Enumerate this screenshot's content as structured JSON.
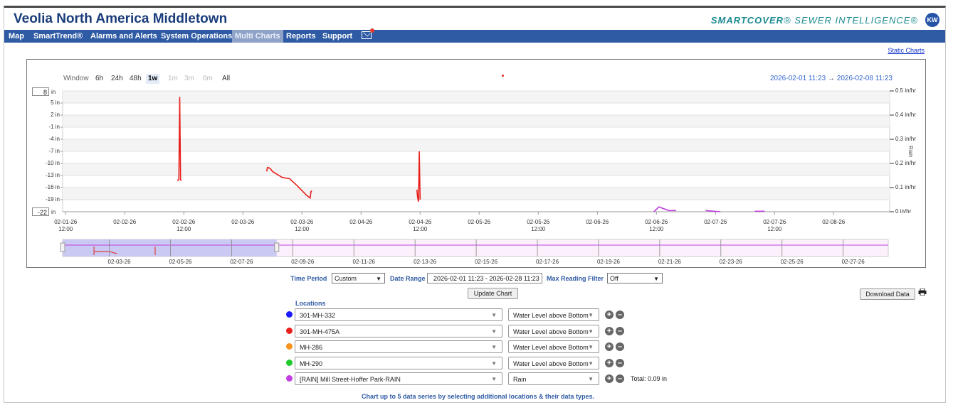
{
  "header": {
    "title": "Veolia North America Middletown",
    "brand_main": "SMARTCOVER",
    "brand_rest": "® SEWER INTELLIGENCE®",
    "avatar": "KW"
  },
  "nav": {
    "items": [
      {
        "label": "Map",
        "active": false
      },
      {
        "label": "SmartTrend®",
        "active": false
      },
      {
        "label": "Alarms and Alerts",
        "active": false
      },
      {
        "label": "System Operations",
        "active": false
      },
      {
        "label": "Multi Charts",
        "active": true
      },
      {
        "label": "Reports",
        "active": false
      },
      {
        "label": "Support",
        "active": false
      }
    ],
    "mail_icon": "envelope-icon"
  },
  "static_charts_link": "Static Charts",
  "range_selector": {
    "label": "Window",
    "buttons": [
      {
        "label": "6h",
        "state": "normal"
      },
      {
        "label": "24h",
        "state": "normal"
      },
      {
        "label": "48h",
        "state": "normal"
      },
      {
        "label": "1w",
        "state": "selected"
      },
      {
        "label": "1m",
        "state": "disabled"
      },
      {
        "label": "3m",
        "state": "disabled"
      },
      {
        "label": "6m",
        "state": "disabled"
      },
      {
        "label": "All",
        "state": "normal"
      }
    ],
    "from": "2026-02-01 11:23",
    "arrow": "→",
    "to": "2026-02-08 11:23"
  },
  "chart_data": {
    "type": "line",
    "y_left_max_input": "8",
    "y_left_min_input": "-22",
    "y_left_unit": "in",
    "y_left_ticks": [
      "5 in",
      "2 in",
      "-1 in",
      "-4 in",
      "-7 in",
      "-10 in",
      "-13 in",
      "-16 in",
      "-19 in"
    ],
    "y_left_range": [
      -22,
      8
    ],
    "y_right_ticks": [
      "0.5 in/hr",
      "0.4 in/hr",
      "0.3 in/hr",
      "0.2 in/hr",
      "0.1 in/hr",
      "0 in/hr"
    ],
    "y_right_range": [
      0,
      0.5
    ],
    "y_right_label": "Rain",
    "x_ticks": [
      {
        "day": "02-01-26",
        "time": "12:00"
      },
      {
        "day": "02-02-26",
        "time": ""
      },
      {
        "day": "02-02-26",
        "time": "12:00"
      },
      {
        "day": "02-03-26",
        "time": ""
      },
      {
        "day": "02-03-26",
        "time": "12:00"
      },
      {
        "day": "02-04-26",
        "time": ""
      },
      {
        "day": "02-04-26",
        "time": "12:00"
      },
      {
        "day": "02-05-26",
        "time": ""
      },
      {
        "day": "02-05-26",
        "time": "12:00"
      },
      {
        "day": "02-06-26",
        "time": ""
      },
      {
        "day": "02-06-26",
        "time": "12:00"
      },
      {
        "day": "02-07-26",
        "time": ""
      },
      {
        "day": "02-07-26",
        "time": "12:00"
      },
      {
        "day": "02-08-26",
        "time": ""
      }
    ],
    "x_range": [
      "2026-02-01 11:23",
      "2026-02-08 11:23"
    ],
    "grid": true,
    "series": [
      {
        "name": "301-MH-475A",
        "color": "#e8201c",
        "axis": "left",
        "points": [
          [
            "2026-02-02 10:40",
            -14.2
          ],
          [
            "2026-02-02 11:00",
            -14.1
          ],
          [
            "2026-02-02 11:10",
            6.5
          ],
          [
            "2026-02-02 11:20",
            -14.0
          ],
          [
            "2026-02-02 11:30",
            -14.3
          ],
          [
            "2026-02-03 04:50",
            -12.0
          ],
          [
            "2026-02-03 05:00",
            -11.0
          ],
          [
            "2026-02-03 05:30",
            -11.2
          ],
          [
            "2026-02-03 06:00",
            -12.0
          ],
          [
            "2026-02-03 08:00",
            -13.5
          ],
          [
            "2026-02-03 09:30",
            -13.8
          ],
          [
            "2026-02-03 11:00",
            -15.5
          ],
          [
            "2026-02-03 13:00",
            -18.0
          ],
          [
            "2026-02-03 13:40",
            -18.6
          ],
          [
            "2026-02-03 13:50",
            -17.0
          ],
          [
            "2026-02-03 14:00",
            -16.8
          ],
          [
            "2026-02-04 11:20",
            -16.5
          ],
          [
            "2026-02-04 11:30",
            -18.5
          ],
          [
            "2026-02-04 11:40",
            -19.5
          ],
          [
            "2026-02-04 11:50",
            -7.0
          ],
          [
            "2026-02-04 12:00",
            -19.0
          ]
        ]
      },
      {
        "name": "[RAIN] Mill Street-Hoffer Park-RAIN",
        "color": "#c23fe0",
        "axis": "right",
        "points": [
          [
            "2026-02-06 11:30",
            0.0
          ],
          [
            "2026-02-06 12:30",
            0.02
          ],
          [
            "2026-02-06 14:30",
            0.005
          ],
          [
            "2026-02-06 16:00",
            0.005
          ],
          [
            "2026-02-06 22:00",
            0.005
          ],
          [
            "2026-02-07 01:00",
            0.0
          ],
          [
            "2026-02-07 08:00",
            0.002
          ],
          [
            "2026-02-07 10:00",
            0.002
          ]
        ]
      }
    ],
    "navigator_ticks": [
      "02-03-26",
      "02-05-26",
      "02-07-26",
      "02-09-26",
      "02-11-26",
      "02-13-26",
      "02-15-26",
      "02-17-26",
      "02-19-26",
      "02-21-26",
      "02-23-26",
      "02-25-26",
      "02-27-26"
    ],
    "navigator_range": [
      "2026-02-01 11:23",
      "2026-02-28 11:23"
    ]
  },
  "controls": {
    "time_period_label": "Time Period",
    "time_period_value": "Custom",
    "date_range_label": "Date Range",
    "date_range_value": "2026-02-01 11:23 - 2026-02-28 11:23",
    "max_reading_label": "Max Reading Filter",
    "max_reading_value": "Off",
    "update_button": "Update Chart",
    "download_button": "Download Data",
    "locations_label": "Locations"
  },
  "locations": [
    {
      "name": "301-MH-332",
      "type": "Water Level above Bottom",
      "color": "#1a1aff",
      "total": ""
    },
    {
      "name": "301-MH-475A",
      "type": "Water Level above Bottom",
      "color": "#e8201c",
      "total": ""
    },
    {
      "name": "MH-286",
      "type": "Water Level above Bottom",
      "color": "#f7941d",
      "total": ""
    },
    {
      "name": "MH-290",
      "type": "Water Level above Bottom",
      "color": "#1fcc2a",
      "total": ""
    },
    {
      "name": "[RAIN] Mill Street-Hoffer Park-RAIN",
      "type": "Rain",
      "color": "#c23fe0",
      "total": "Total: 0.09 in"
    }
  ],
  "footer_note": "Chart up to 5 data series by selecting additional locations & their data types."
}
